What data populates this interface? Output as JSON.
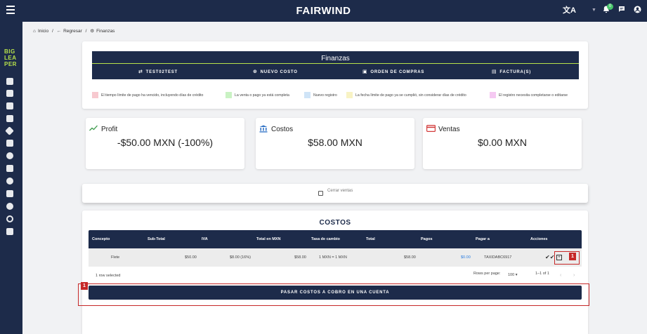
{
  "header": {
    "brand": "FAIRWIND",
    "notification_count": "0"
  },
  "logo": {
    "line1": "BIG",
    "line2": "LEA",
    "line3": "PER"
  },
  "breadcrumb": {
    "home": "Inicio",
    "back": "Regresar",
    "current": "Finanzas",
    "sep": "/"
  },
  "finanzas": {
    "title": "Finanzas",
    "actions": [
      {
        "label": "TEST02TEST",
        "icon": "⇄"
      },
      {
        "label": "NUEVO COSTO",
        "icon": "⊕"
      },
      {
        "label": "ORDEN DE COMPRAS",
        "icon": "▣"
      },
      {
        "label": "FACTURA(S)",
        "icon": "▤"
      }
    ]
  },
  "legend": [
    {
      "color": "#f7c9cf",
      "text": "El tiempo límite de pago ha vencido, incluyendo días de crédito"
    },
    {
      "color": "#c9f2c3",
      "text": "La venta o pago ya está completa"
    },
    {
      "color": "#cfe4f7",
      "text": "Nuevo registro"
    },
    {
      "color": "#f8f3c4",
      "text": "La fecha límite de pago ya se cumplió, sin considerar días de crédito"
    },
    {
      "color": "#f5c9f2",
      "text": "El registro necesita completarse o editarse"
    }
  ],
  "kpis": [
    {
      "label": "Profit",
      "value": "-$50.00 MXN (-100%)",
      "color": "#3a9a4a",
      "icon": "trending-up-icon"
    },
    {
      "label": "Costos",
      "value": "$58.00 MXN",
      "color": "#2b6fc4",
      "icon": "bank-icon"
    },
    {
      "label": "Ventas",
      "value": "$0.00 MXN",
      "color": "#d33c3c",
      "icon": "credit-card-icon"
    }
  ],
  "close_sales": {
    "label": "Cerrar ventas"
  },
  "costos": {
    "title": "COSTOS",
    "columns": [
      "Concepto",
      "Sub-Total",
      "IVA",
      "Total en MXN",
      "Tasa de cambio",
      "Total",
      "Pagos",
      "Pagar a",
      "Acciones"
    ],
    "rows": [
      {
        "concepto": "Flete",
        "subtotal": "$50.00",
        "iva": "$8.00 (16%)",
        "total_mxn": "$58.00",
        "tasa": "1 MXN = 1 MXN",
        "total": "",
        "pagos": "$58.00",
        "pagos_link": "$0.00",
        "pagar_a": "TAXIDABC6917"
      }
    ],
    "selected_info": "1 row selected",
    "rows_per_page_label": "Rows per page:",
    "rows_per_page": "100",
    "range": "1–1 of 1"
  },
  "annotations": {
    "marker_small": "1",
    "marker_big": "1"
  },
  "pasar_button": "PASAR COSTOS A COBRO EN UNA CUENTA"
}
